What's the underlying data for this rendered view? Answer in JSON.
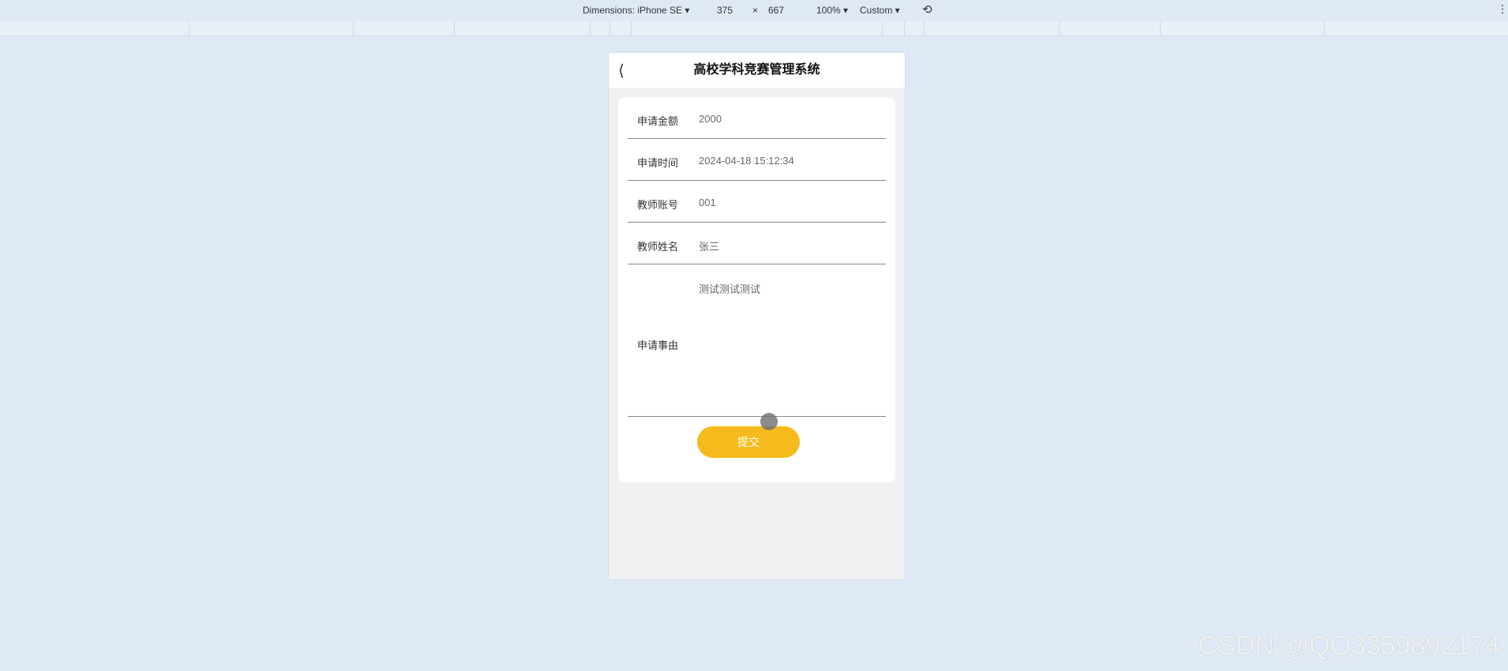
{
  "devtools": {
    "device": "Dimensions: iPhone SE",
    "width": "375",
    "times": "×",
    "height": "667",
    "zoom": "100%",
    "throttle": "Custom",
    "rotate_icon": "rotate-icon",
    "more_icon": "more-vertical-icon"
  },
  "app": {
    "title": "高校学科竞赛管理系统",
    "back_icon": "chevron-left-icon"
  },
  "form": {
    "fields": [
      {
        "label": "申请金额",
        "value": "2000"
      },
      {
        "label": "申请时间",
        "value": "2024-04-18 15:12:34"
      },
      {
        "label": "教师账号",
        "value": "001"
      },
      {
        "label": "教师姓名",
        "value": "张三"
      }
    ],
    "reason": {
      "label": "申请事由",
      "value": "测试测试测试"
    },
    "submit_label": "提交"
  },
  "colors": {
    "accent": "#f5bb1d",
    "background": "#dfe9f6"
  },
  "watermark": "CSDN @QQ3359892174"
}
